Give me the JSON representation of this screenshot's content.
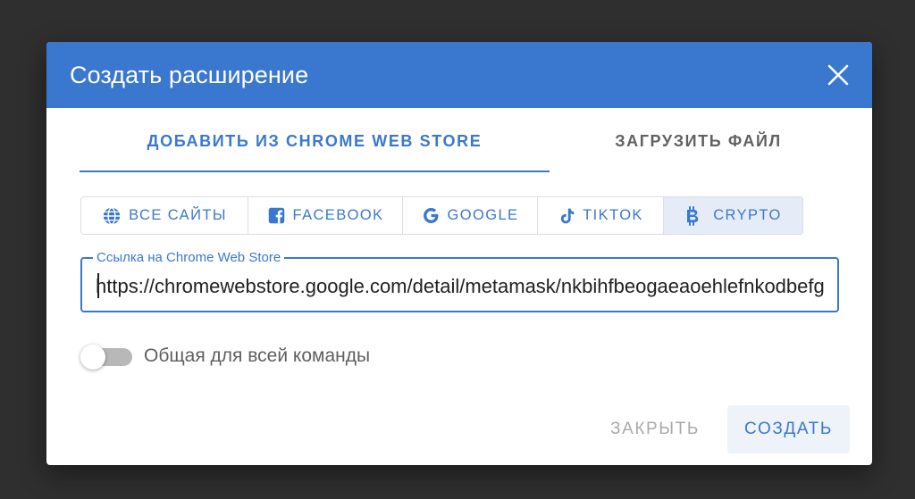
{
  "dialog": {
    "title": "Создать расширение",
    "close_icon": "close-icon"
  },
  "tabs": [
    {
      "label": "ДОБАВИТЬ ИЗ CHROME WEB STORE",
      "active": true
    },
    {
      "label": "ЗАГРУЗИТЬ ФАЙЛ",
      "active": false
    }
  ],
  "presets": [
    {
      "label": "ВСЕ САЙТЫ",
      "icon": "globe-icon"
    },
    {
      "label": "FACEBOOK",
      "icon": "facebook-icon"
    },
    {
      "label": "GOOGLE",
      "icon": "google-icon"
    },
    {
      "label": "TIKTOK",
      "icon": "tiktok-icon"
    },
    {
      "label": "CRYPTO",
      "icon": "bitcoin-icon",
      "active": true
    }
  ],
  "store_link": {
    "label": "Ссылка на Chrome Web Store",
    "value": "https://chromewebstore.google.com/detail/metamask/nkbihfbeogaeaoehlefnkodbefgpgknn"
  },
  "shared_toggle": {
    "label": "Общая для всей команды",
    "checked": false
  },
  "actions": {
    "close_label": "ЗАКРЫТЬ",
    "create_label": "СОЗДАТЬ"
  },
  "colors": {
    "accent": "#3a78cf",
    "backdrop": "#2f2f2f",
    "active_preset_bg": "#e5ecf8"
  }
}
